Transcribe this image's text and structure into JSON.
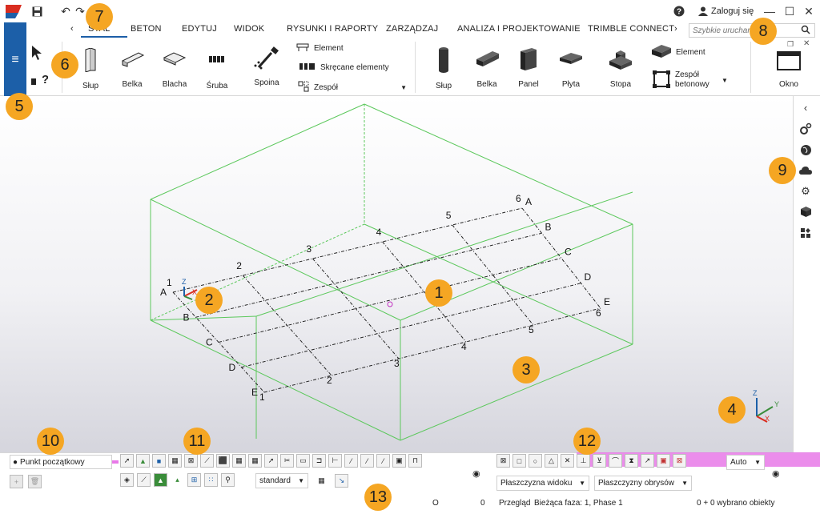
{
  "app": {
    "login_label": "Zaloguj się"
  },
  "tabs": [
    {
      "label": "STAL"
    },
    {
      "label": "BETON"
    },
    {
      "label": "EDYTUJ"
    },
    {
      "label": "WIDOK"
    },
    {
      "label": "RYSUNKI I RAPORTY"
    },
    {
      "label": "ZARZĄDZAJ"
    },
    {
      "label": "ANALIZA I PROJEKTOWANIE"
    },
    {
      "label": "TRIMBLE CONNECT"
    }
  ],
  "quick_launch": {
    "placeholder": "Szybkie uruchamianie"
  },
  "ribbon": {
    "steel": {
      "column": "Słup",
      "beam": "Belka",
      "plate": "Blacha",
      "bolt": "Śruba",
      "weld": "Spoina",
      "element": "Element",
      "twisted": "Skręcane elementy",
      "assembly": "Zespół"
    },
    "concrete": {
      "column": "Słup",
      "beam": "Belka",
      "panel": "Panel",
      "slab": "Płyta",
      "footing": "Stopa",
      "element": "Element",
      "assembly": "Zespół betonowy"
    },
    "window": "Okno"
  },
  "model": {
    "gridlines_x": [
      "1",
      "2",
      "3",
      "4",
      "5",
      "6"
    ],
    "gridlines_y": [
      "A",
      "B",
      "C",
      "D",
      "E"
    ],
    "axis_labels": {
      "x": "X",
      "y": "Y",
      "z": "Z"
    }
  },
  "callouts": [
    "1",
    "2",
    "3",
    "4",
    "5",
    "6",
    "7",
    "8",
    "9",
    "10",
    "11",
    "12",
    "13"
  ],
  "bottom": {
    "origin_label": "Punkt początkowy",
    "style_select": "standard",
    "auto_select": "Auto",
    "view_plane_select": "Płaszczyzna widoku",
    "outline_plane_select": "Płaszczyzny obrysów",
    "status_o": "O",
    "status_count": "0",
    "phase_label": "Przegląd",
    "phase_value": "Bieżąca faza: 1, Phase 1",
    "selection_info": "0 + 0 wybrano obiekty"
  },
  "colors": {
    "accent": "#1c5fa8",
    "callout": "#f5a623",
    "bbox": "#5cc85c",
    "highlight": "#e879e8"
  }
}
